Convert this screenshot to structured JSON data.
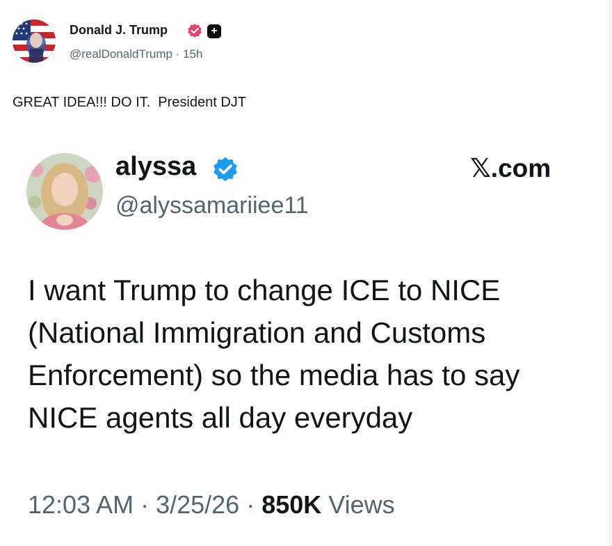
{
  "post": {
    "author": {
      "display_name": "Donald J. Trump",
      "handle_and_time": "@realDonaldTrump · 15h",
      "avatar_icon": "flag-portrait-avatar",
      "verified_icon": "verified-badge-icon",
      "verified_color": "#e8436a",
      "plus_label": "+"
    },
    "text": "GREAT IDEA!!! DO IT.  President DJT"
  },
  "embedded_post": {
    "display_name": "alyssa",
    "handle": "@alyssamariiee11",
    "verified_color": "#1d9bf0",
    "source_label": "𝕏.com",
    "body_lines": [
      "I want Trump to change ICE to NICE",
      "(National Immigration and Customs",
      "Enforcement) so the media has to say",
      "NICE agents all day everyday"
    ],
    "footer": {
      "time_date": "12:03 AM · 3/25/26 · ",
      "views_count": "850K",
      "views_label": " Views"
    }
  }
}
